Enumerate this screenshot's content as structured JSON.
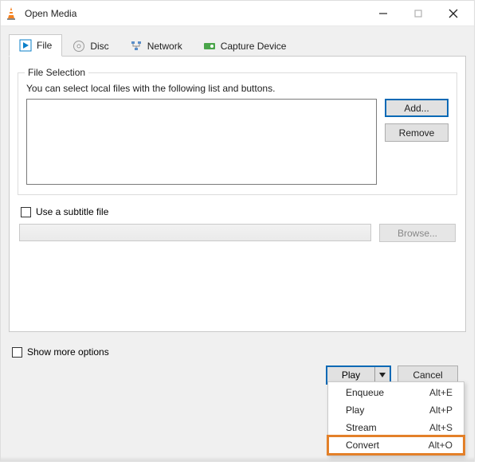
{
  "title": "Open Media",
  "tabs": {
    "file": "File",
    "disc": "Disc",
    "network": "Network",
    "capture": "Capture Device"
  },
  "file_selection": {
    "legend": "File Selection",
    "desc": "You can select local files with the following list and buttons.",
    "add": "Add...",
    "remove": "Remove"
  },
  "subtitle": {
    "checkbox_label": "Use a subtitle file",
    "browse": "Browse..."
  },
  "show_more": "Show more options",
  "play_button": "Play",
  "cancel_button": "Cancel",
  "menu": {
    "enqueue": {
      "label": "Enqueue",
      "shortcut": "Alt+E"
    },
    "play": {
      "label": "Play",
      "shortcut": "Alt+P"
    },
    "stream": {
      "label": "Stream",
      "shortcut": "Alt+S"
    },
    "convert": {
      "label": "Convert",
      "shortcut": "Alt+O"
    }
  }
}
